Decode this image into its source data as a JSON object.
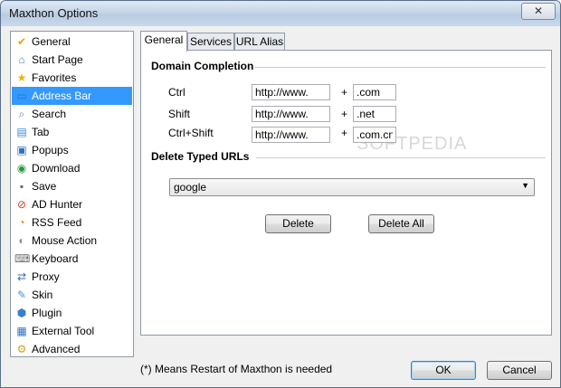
{
  "window": {
    "title": "Maxthon Options",
    "close_label": "✕"
  },
  "sidebar": {
    "items": [
      {
        "label": "General",
        "icon": "check-folder-icon",
        "color": "#e8a400",
        "glyph": "✔"
      },
      {
        "label": "Start Page",
        "icon": "home-icon",
        "color": "#4a7bc8",
        "glyph": "⌂"
      },
      {
        "label": "Favorites",
        "icon": "star-icon",
        "color": "#f0b400",
        "glyph": "★"
      },
      {
        "label": "Address Bar",
        "icon": "address-bar-icon",
        "color": "#1e73c8",
        "glyph": "▭"
      },
      {
        "label": "Search",
        "icon": "search-icon",
        "color": "#5a8ac0",
        "glyph": "⌕"
      },
      {
        "label": "Tab",
        "icon": "tab-icon",
        "color": "#3a8ad8",
        "glyph": "▤"
      },
      {
        "label": "Popups",
        "icon": "popup-icon",
        "color": "#3070c0",
        "glyph": "▣"
      },
      {
        "label": "Download",
        "icon": "download-globe-icon",
        "color": "#2a9a40",
        "glyph": "◉"
      },
      {
        "label": "Save",
        "icon": "save-disk-icon",
        "color": "#5a6a8a",
        "glyph": "▪"
      },
      {
        "label": "AD Hunter",
        "icon": "ad-hunter-icon",
        "color": "#d04020",
        "glyph": "⊘"
      },
      {
        "label": "RSS Feed",
        "icon": "rss-icon",
        "color": "#f08020",
        "glyph": "◔"
      },
      {
        "label": "Mouse Action",
        "icon": "mouse-icon",
        "color": "#909090",
        "glyph": "◐"
      },
      {
        "label": "Keyboard",
        "icon": "keyboard-icon",
        "color": "#707070",
        "glyph": "⌨"
      },
      {
        "label": "Proxy",
        "icon": "proxy-icon",
        "color": "#3a6ab0",
        "glyph": "⇄"
      },
      {
        "label": "Skin",
        "icon": "skin-icon",
        "color": "#4a90d0",
        "glyph": "✎"
      },
      {
        "label": "Plugin",
        "icon": "plugin-icon",
        "color": "#3a80c8",
        "glyph": "⬢"
      },
      {
        "label": "External Tool",
        "icon": "external-tool-icon",
        "color": "#2a70c0",
        "glyph": "▦"
      },
      {
        "label": "Advanced",
        "icon": "advanced-gear-icon",
        "color": "#d0a020",
        "glyph": "⚙"
      }
    ],
    "selected_index": 3,
    "selected_color": "#3399ff"
  },
  "tabs": [
    {
      "label": "General",
      "active": true
    },
    {
      "label": "Services",
      "active": false
    },
    {
      "label": "URL Alias",
      "active": false
    }
  ],
  "domain_completion": {
    "heading": "Domain Completion",
    "rows": [
      {
        "label": "Ctrl",
        "prefix": "http://www.",
        "suffix": ".com"
      },
      {
        "label": "Shift",
        "prefix": "http://www.",
        "suffix": ".net"
      },
      {
        "label": "Ctrl+Shift",
        "prefix": "http://www.",
        "suffix": ".com.cn"
      }
    ],
    "plus": "+"
  },
  "typed_urls": {
    "heading": "Delete Typed URLs",
    "selected": "google",
    "delete_label": "Delete",
    "delete_all_label": "Delete All"
  },
  "footer": {
    "note": "(*) Means Restart of Maxthon is needed",
    "ok_label": "OK",
    "cancel_label": "Cancel"
  },
  "watermark": "SOFTPEDIA"
}
